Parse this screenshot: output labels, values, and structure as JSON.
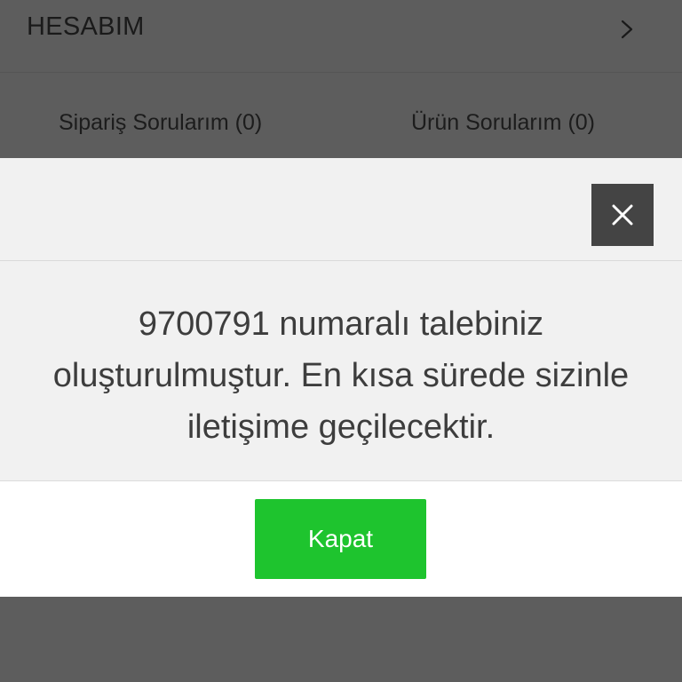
{
  "account": {
    "title": "HESABIM",
    "chevron_icon": "chevron-right-icon"
  },
  "questions": {
    "order_label": "Sipariş Sorularım (0)",
    "product_label": "Ürün Sorularım (0)"
  },
  "modal": {
    "close_icon": "close-icon",
    "message": "9700791 numaralı talebiniz oluşturulmuştur. En kısa sürede sizinle iletişime geçilecektir.",
    "button_label": "Kapat"
  },
  "colors": {
    "overlay": "#5d5d5d",
    "close_button": "#444444",
    "primary_button": "#1ec42e",
    "modal_background": "#f1f1f1"
  }
}
